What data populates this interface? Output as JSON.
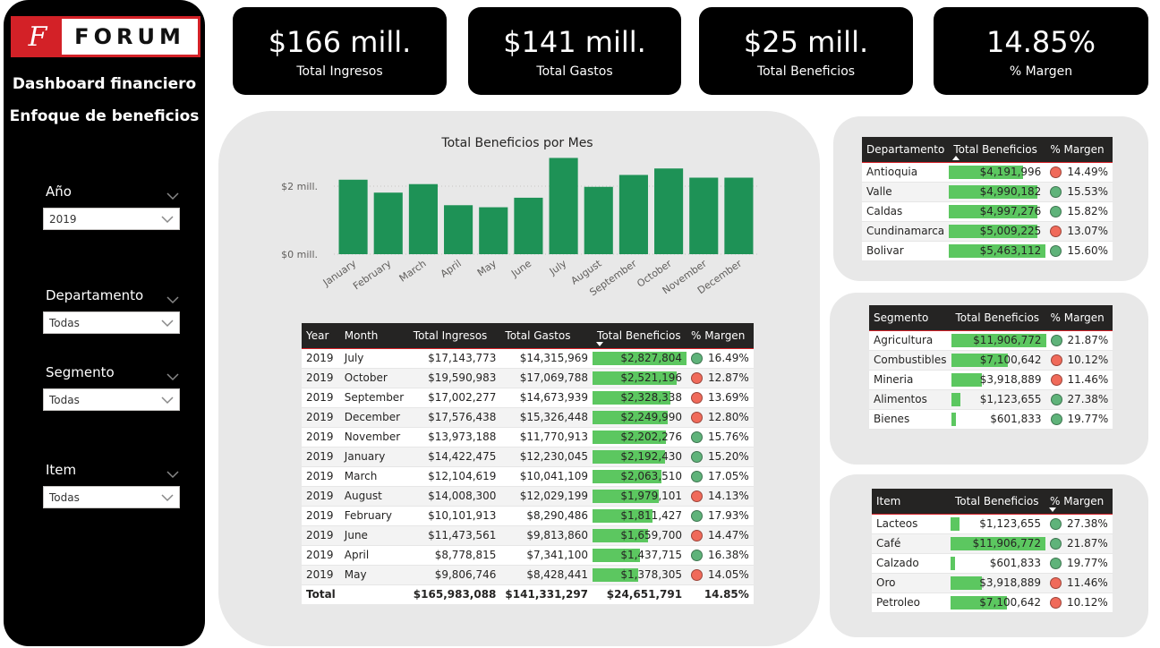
{
  "brand": {
    "mark": "F",
    "name": "FORUM"
  },
  "sidebar": {
    "title1": "Dashboard financiero",
    "title2": "Enfoque de beneficios",
    "slicers": [
      {
        "label": "Año",
        "value": "2019"
      },
      {
        "label": "Departamento",
        "value": "Todas"
      },
      {
        "label": "Segmento",
        "value": "Todas"
      },
      {
        "label": "Item",
        "value": "Todas"
      }
    ]
  },
  "kpis": [
    {
      "value": "$166 mill.",
      "label": "Total Ingresos"
    },
    {
      "value": "$141 mill.",
      "label": "Total Gastos"
    },
    {
      "value": "$25 mill.",
      "label": "Total Beneficios"
    },
    {
      "value": "14.85%",
      "label": "% Margen"
    }
  ],
  "colors": {
    "bar": "#1e9256",
    "data_bar": "#5cc760",
    "good": "#5fb37a",
    "bad": "#f06a5a",
    "accent": "#d32127"
  },
  "chart_data": {
    "type": "bar",
    "title": "Total Beneficios por Mes",
    "categories": [
      "January",
      "February",
      "March",
      "April",
      "May",
      "June",
      "July",
      "August",
      "September",
      "October",
      "November",
      "December"
    ],
    "values": [
      2.19,
      1.81,
      2.06,
      1.44,
      1.38,
      1.66,
      2.83,
      1.98,
      2.33,
      2.52,
      2.25,
      2.25
    ],
    "ylim": [
      0,
      3.0
    ],
    "ytick_values": [
      0,
      2
    ],
    "ytick_labels": [
      "$0 mill.",
      "$2 mill."
    ],
    "grid": true
  },
  "month_table": {
    "headers": [
      "Year",
      "Month",
      "Total Ingresos",
      "Total Gastos",
      "Total Beneficios",
      "% Margen"
    ],
    "rows": [
      {
        "year": "2019",
        "month": "July",
        "ing": "$17,143,773",
        "gas": "$14,315,969",
        "ben": "$2,827,804",
        "ben_v": 2827804,
        "mar": "16.49%",
        "good": true
      },
      {
        "year": "2019",
        "month": "October",
        "ing": "$19,590,983",
        "gas": "$17,069,788",
        "ben": "$2,521,196",
        "ben_v": 2521196,
        "mar": "12.87%",
        "good": false
      },
      {
        "year": "2019",
        "month": "September",
        "ing": "$17,002,277",
        "gas": "$14,673,939",
        "ben": "$2,328,338",
        "ben_v": 2328338,
        "mar": "13.69%",
        "good": false
      },
      {
        "year": "2019",
        "month": "December",
        "ing": "$17,576,438",
        "gas": "$15,326,448",
        "ben": "$2,249,990",
        "ben_v": 2249990,
        "mar": "12.80%",
        "good": false
      },
      {
        "year": "2019",
        "month": "November",
        "ing": "$13,973,188",
        "gas": "$11,770,913",
        "ben": "$2,202,276",
        "ben_v": 2202276,
        "mar": "15.76%",
        "good": true
      },
      {
        "year": "2019",
        "month": "January",
        "ing": "$14,422,475",
        "gas": "$12,230,045",
        "ben": "$2,192,430",
        "ben_v": 2192430,
        "mar": "15.20%",
        "good": true
      },
      {
        "year": "2019",
        "month": "March",
        "ing": "$12,104,619",
        "gas": "$10,041,109",
        "ben": "$2,063,510",
        "ben_v": 2063510,
        "mar": "17.05%",
        "good": true
      },
      {
        "year": "2019",
        "month": "August",
        "ing": "$14,008,300",
        "gas": "$12,029,199",
        "ben": "$1,979,101",
        "ben_v": 1979101,
        "mar": "14.13%",
        "good": false
      },
      {
        "year": "2019",
        "month": "February",
        "ing": "$10,101,913",
        "gas": "$8,290,486",
        "ben": "$1,811,427",
        "ben_v": 1811427,
        "mar": "17.93%",
        "good": true
      },
      {
        "year": "2019",
        "month": "June",
        "ing": "$11,473,561",
        "gas": "$9,813,860",
        "ben": "$1,659,700",
        "ben_v": 1659700,
        "mar": "14.47%",
        "good": false
      },
      {
        "year": "2019",
        "month": "April",
        "ing": "$8,778,815",
        "gas": "$7,341,100",
        "ben": "$1,437,715",
        "ben_v": 1437715,
        "mar": "16.38%",
        "good": true
      },
      {
        "year": "2019",
        "month": "May",
        "ing": "$9,806,746",
        "gas": "$8,428,441",
        "ben": "$1,378,305",
        "ben_v": 1378305,
        "mar": "14.05%",
        "good": false
      }
    ],
    "total": {
      "label": "Total",
      "ing": "$165,983,088",
      "gas": "$141,331,297",
      "ben": "$24,651,791",
      "mar": "14.85%"
    }
  },
  "dept_table": {
    "headers": [
      "Departamento",
      "Total Beneficios",
      "% Margen"
    ],
    "rows": [
      {
        "name": "Antioquia",
        "ben": "$4,191,996",
        "ben_v": 4191996,
        "mar": "14.49%",
        "good": false
      },
      {
        "name": "Valle",
        "ben": "$4,990,182",
        "ben_v": 4990182,
        "mar": "15.53%",
        "good": true
      },
      {
        "name": "Caldas",
        "ben": "$4,997,276",
        "ben_v": 4997276,
        "mar": "15.82%",
        "good": true
      },
      {
        "name": "Cundinamarca",
        "ben": "$5,009,225",
        "ben_v": 5009225,
        "mar": "13.07%",
        "good": false
      },
      {
        "name": "Bolivar",
        "ben": "$5,463,112",
        "ben_v": 5463112,
        "mar": "15.60%",
        "good": true
      }
    ]
  },
  "seg_table": {
    "headers": [
      "Segmento",
      "Total Beneficios",
      "% Margen"
    ],
    "rows": [
      {
        "name": "Agricultura",
        "ben": "$11,906,772",
        "ben_v": 11906772,
        "mar": "21.87%",
        "good": true
      },
      {
        "name": "Combustibles",
        "ben": "$7,100,642",
        "ben_v": 7100642,
        "mar": "10.12%",
        "good": false
      },
      {
        "name": "Mineria",
        "ben": "$3,918,889",
        "ben_v": 3918889,
        "mar": "11.46%",
        "good": false
      },
      {
        "name": "Alimentos",
        "ben": "$1,123,655",
        "ben_v": 1123655,
        "mar": "27.38%",
        "good": true
      },
      {
        "name": "Bienes",
        "ben": "$601,833",
        "ben_v": 601833,
        "mar": "19.77%",
        "good": true
      }
    ]
  },
  "item_table": {
    "headers": [
      "Item",
      "Total Beneficios",
      "% Margen"
    ],
    "rows": [
      {
        "name": "Lacteos",
        "ben": "$1,123,655",
        "ben_v": 1123655,
        "mar": "27.38%",
        "good": true
      },
      {
        "name": "Café",
        "ben": "$11,906,772",
        "ben_v": 11906772,
        "mar": "21.87%",
        "good": true
      },
      {
        "name": "Calzado",
        "ben": "$601,833",
        "ben_v": 601833,
        "mar": "19.77%",
        "good": true
      },
      {
        "name": "Oro",
        "ben": "$3,918,889",
        "ben_v": 3918889,
        "mar": "11.46%",
        "good": false
      },
      {
        "name": "Petroleo",
        "ben": "$7,100,642",
        "ben_v": 7100642,
        "mar": "10.12%",
        "good": false
      }
    ]
  }
}
